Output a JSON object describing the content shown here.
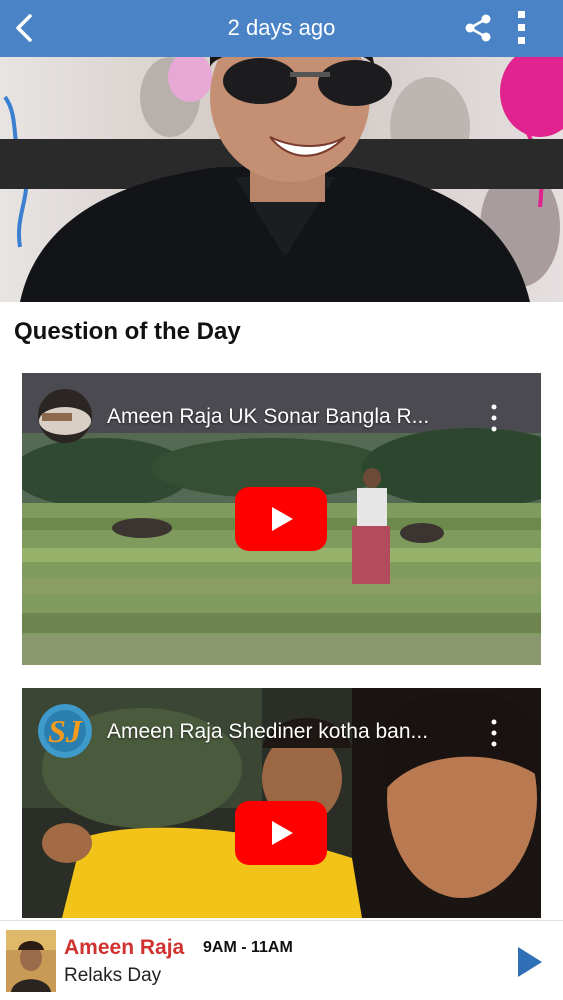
{
  "header": {
    "title": "2 days ago",
    "back_icon": "chevron-left-icon",
    "share_icon": "share-icon",
    "more_icon": "more-vertical-icon",
    "bg_color": "#4a84c6"
  },
  "hero": {
    "alt": "Photo of smiling man wearing sunglasses and black shirt"
  },
  "section": {
    "title": "Question of the Day"
  },
  "videos": [
    {
      "title": "Ameen Raja UK Sonar Bangla R...",
      "play_icon": "youtube-play-icon"
    },
    {
      "title": "Ameen Raja Shediner kotha ban...",
      "play_icon": "youtube-play-icon"
    }
  ],
  "player": {
    "host": "Ameen Raja",
    "time": "9AM - 11AM",
    "show": "Relaks Day",
    "play_icon": "play-icon",
    "accent": "#d0322f",
    "play_color": "#2f6fb5"
  }
}
